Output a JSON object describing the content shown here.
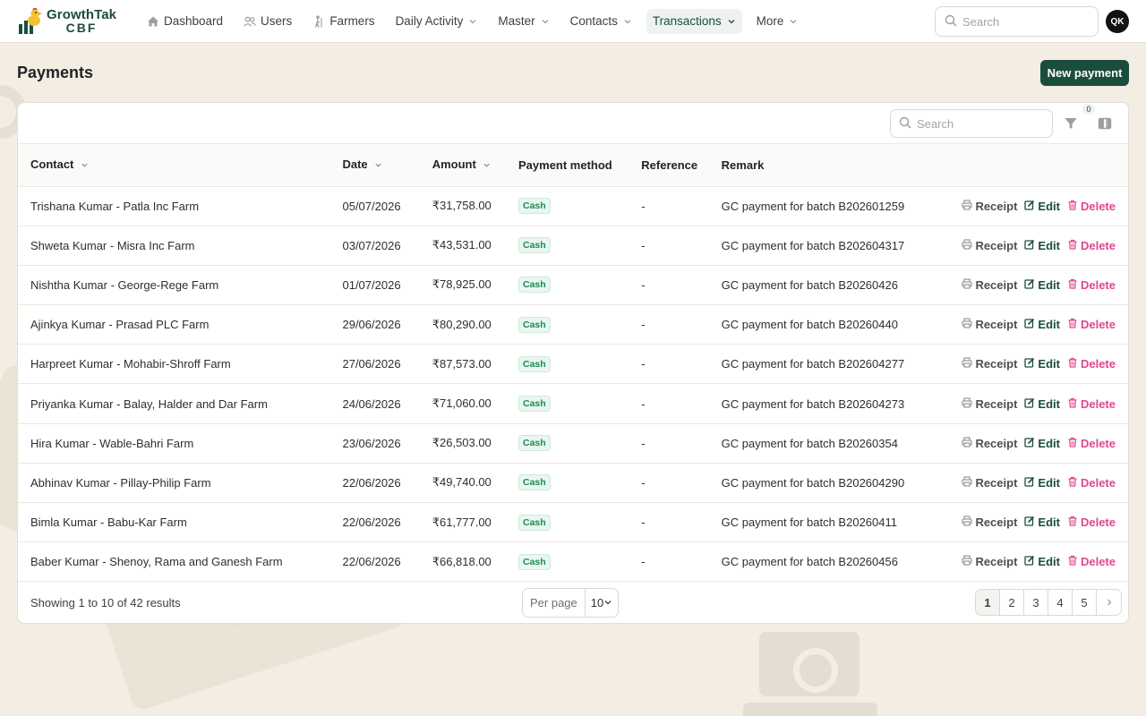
{
  "app": {
    "brand_name": "GrowthTak",
    "brand_sub": "CBF",
    "avatar_initials": "QK"
  },
  "nav": {
    "items": [
      {
        "label": "Dashboard",
        "icon": "home-icon",
        "dropdown": false,
        "active": false
      },
      {
        "label": "Users",
        "icon": "users-icon",
        "dropdown": false,
        "active": false
      },
      {
        "label": "Farmers",
        "icon": "farmer-icon",
        "dropdown": false,
        "active": false
      },
      {
        "label": "Daily Activity",
        "icon": null,
        "dropdown": true,
        "active": false
      },
      {
        "label": "Master",
        "icon": null,
        "dropdown": true,
        "active": false
      },
      {
        "label": "Contacts",
        "icon": null,
        "dropdown": true,
        "active": false
      },
      {
        "label": "Transactions",
        "icon": null,
        "dropdown": true,
        "active": true
      },
      {
        "label": "More",
        "icon": null,
        "dropdown": true,
        "active": false
      }
    ],
    "search_placeholder": "Search"
  },
  "page": {
    "title": "Payments",
    "new_button": "New payment"
  },
  "toolbar": {
    "search_placeholder": "Search",
    "filter_count": "0"
  },
  "table": {
    "columns": [
      "Contact",
      "Date",
      "Amount",
      "Payment method",
      "Reference",
      "Remark"
    ],
    "sortable": [
      true,
      true,
      true,
      false,
      false,
      false
    ],
    "action_labels": {
      "receipt": "Receipt",
      "edit": "Edit",
      "delete": "Delete"
    },
    "rows": [
      {
        "contact": "Trishana Kumar - Patla Inc Farm",
        "date": "05/07/2026",
        "amount": "₹31,758.00",
        "method": "Cash",
        "reference": "-",
        "remark": "GC payment for batch B202601259"
      },
      {
        "contact": "Shweta Kumar - Misra Inc Farm",
        "date": "03/07/2026",
        "amount": "₹43,531.00",
        "method": "Cash",
        "reference": "-",
        "remark": "GC payment for batch B202604317"
      },
      {
        "contact": "Nishtha Kumar - George-Rege Farm",
        "date": "01/07/2026",
        "amount": "₹78,925.00",
        "method": "Cash",
        "reference": "-",
        "remark": "GC payment for batch B20260426"
      },
      {
        "contact": "Ajinkya Kumar - Prasad PLC Farm",
        "date": "29/06/2026",
        "amount": "₹80,290.00",
        "method": "Cash",
        "reference": "-",
        "remark": "GC payment for batch B20260440"
      },
      {
        "contact": "Harpreet Kumar - Mohabir-Shroff Farm",
        "date": "27/06/2026",
        "amount": "₹87,573.00",
        "method": "Cash",
        "reference": "-",
        "remark": "GC payment for batch B202604277"
      },
      {
        "contact": "Priyanka Kumar - Balay, Halder and Dar Farm",
        "date": "24/06/2026",
        "amount": "₹71,060.00",
        "method": "Cash",
        "reference": "-",
        "remark": "GC payment for batch B202604273"
      },
      {
        "contact": "Hira Kumar - Wable-Bahri Farm",
        "date": "23/06/2026",
        "amount": "₹26,503.00",
        "method": "Cash",
        "reference": "-",
        "remark": "GC payment for batch B20260354"
      },
      {
        "contact": "Abhinav Kumar - Pillay-Philip Farm",
        "date": "22/06/2026",
        "amount": "₹49,740.00",
        "method": "Cash",
        "reference": "-",
        "remark": "GC payment for batch B202604290"
      },
      {
        "contact": "Bimla Kumar - Babu-Kar Farm",
        "date": "22/06/2026",
        "amount": "₹61,777.00",
        "method": "Cash",
        "reference": "-",
        "remark": "GC payment for batch B20260411"
      },
      {
        "contact": "Baber Kumar - Shenoy, Rama and Ganesh Farm",
        "date": "22/06/2026",
        "amount": "₹66,818.00",
        "method": "Cash",
        "reference": "-",
        "remark": "GC payment for batch B20260456"
      }
    ]
  },
  "footer": {
    "showing": "Showing 1 to 10 of 42 results",
    "per_page_label": "Per page",
    "per_page_value": "10",
    "pages": [
      "1",
      "2",
      "3",
      "4",
      "5"
    ],
    "current_page": "1"
  },
  "colors": {
    "brand": "#1b4d3e",
    "background": "#f3ede3",
    "cash_badge": "#1d8a55",
    "delete": "#e0478f"
  }
}
